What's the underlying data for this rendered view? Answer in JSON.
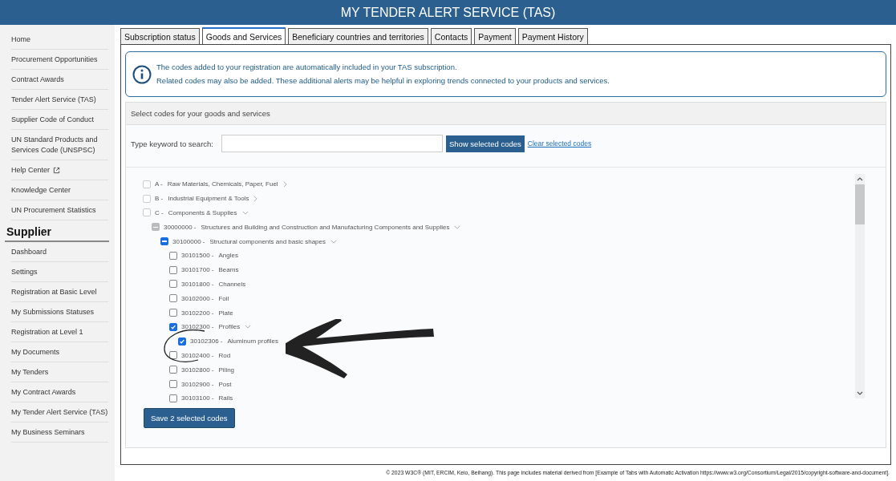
{
  "header": {
    "title": "MY TENDER ALERT SERVICE (TAS)"
  },
  "sidebar": {
    "items": [
      {
        "label": "Home",
        "external": false
      },
      {
        "label": "Procurement Opportunities",
        "external": false
      },
      {
        "label": "Contract Awards",
        "external": false
      },
      {
        "label": "Tender Alert Service (TAS)",
        "external": false
      },
      {
        "label": "Supplier Code of Conduct",
        "external": false
      },
      {
        "label": "UN Standard Products and Services Code (UNSPSC)",
        "external": false
      },
      {
        "label": "Help Center",
        "external": true
      },
      {
        "label": "Knowledge Center",
        "external": false
      },
      {
        "label": "UN Procurement Statistics",
        "external": false
      }
    ],
    "section_title": "Supplier",
    "section_items": [
      "Dashboard",
      "Settings",
      "Registration at Basic Level",
      "My Submissions Statuses",
      "Registration at Level 1",
      "My Documents",
      "My Tenders",
      "My Contract Awards",
      "My Tender Alert Service (TAS)",
      "My Business Seminars"
    ]
  },
  "tabs": [
    {
      "label": "Subscription status",
      "selected": false
    },
    {
      "label": "Goods and Services",
      "selected": true
    },
    {
      "label": "Beneficiary countries and territories",
      "selected": false
    },
    {
      "label": "Contacts",
      "selected": false
    },
    {
      "label": "Payment",
      "selected": false
    },
    {
      "label": "Payment History",
      "selected": false
    }
  ],
  "info": {
    "lines": [
      "The codes added to your registration are automatically included in your TAS subscription.",
      "Related codes may also be added. These additional alerts may be helpful in exploring trends connected to your products and services."
    ]
  },
  "panel": {
    "title": "Select codes for your goods and services",
    "search_label": "Type keyword to search:",
    "show_button": "Show selected codes",
    "clear_link": "Clear selected codes",
    "tree": [
      {
        "code": "A -",
        "label": "Raw Materials, Chemicals, Paper, Fuel",
        "checked": false,
        "mixed": false,
        "disabled": true,
        "expanded": false
      },
      {
        "code": "B -",
        "label": "Industrial Equipment & Tools",
        "checked": false,
        "mixed": false,
        "disabled": true,
        "expanded": false
      },
      {
        "code": "C -",
        "label": "Components & Supplies",
        "checked": false,
        "mixed": false,
        "disabled": true,
        "expanded": true,
        "children": [
          {
            "code": "30000000 -",
            "label": "Structures and Building and Construction and Manufacturing Components and Supplies",
            "checked": false,
            "mixed": true,
            "disabled": true,
            "expanded": true,
            "children": [
              {
                "code": "30100000 -",
                "label": "Structural components and basic shapes",
                "checked": false,
                "mixed": true,
                "disabled": false,
                "expanded": true,
                "children": [
                  {
                    "code": "30101500 -",
                    "label": "Angles",
                    "checked": false,
                    "mixed": false,
                    "disabled": false
                  },
                  {
                    "code": "30101700 -",
                    "label": "Beams",
                    "checked": false,
                    "mixed": false,
                    "disabled": false
                  },
                  {
                    "code": "30101800 -",
                    "label": "Channels",
                    "checked": false,
                    "mixed": false,
                    "disabled": false
                  },
                  {
                    "code": "30102000 -",
                    "label": "Foil",
                    "checked": false,
                    "mixed": false,
                    "disabled": false
                  },
                  {
                    "code": "30102200 -",
                    "label": "Plate",
                    "checked": false,
                    "mixed": false,
                    "disabled": false
                  },
                  {
                    "code": "30102300 -",
                    "label": "Profiles",
                    "checked": true,
                    "mixed": false,
                    "disabled": false,
                    "expanded": true,
                    "children": [
                      {
                        "code": "30102306 -",
                        "label": "Aluminum profiles",
                        "checked": true,
                        "mixed": false,
                        "disabled": false
                      }
                    ]
                  },
                  {
                    "code": "30102400 -",
                    "label": "Rod",
                    "checked": false,
                    "mixed": false,
                    "disabled": false
                  },
                  {
                    "code": "30102800 -",
                    "label": "Piling",
                    "checked": false,
                    "mixed": false,
                    "disabled": false
                  },
                  {
                    "code": "30102900 -",
                    "label": "Post",
                    "checked": false,
                    "mixed": false,
                    "disabled": false
                  },
                  {
                    "code": "30103100 -",
                    "label": "Rails",
                    "checked": false,
                    "mixed": false,
                    "disabled": false
                  }
                ]
              }
            ]
          }
        ]
      }
    ],
    "save_button": "Save 2 selected codes"
  },
  "footer": "© 2023 W3C® (MIT, ERCIM, Keio, Beihang). This page includes material derived from [Example of Tabs with Automatic Activation https://www.w3.org/Consortium/Legal/2015/copyright-software-and-document]."
}
